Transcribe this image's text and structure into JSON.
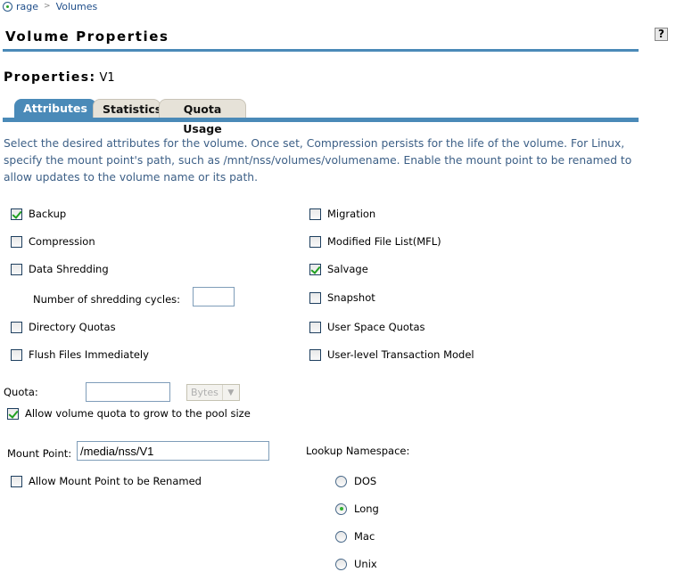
{
  "breadcrumb": {
    "items": [
      "rage",
      "Volumes"
    ],
    "separator": ">"
  },
  "header": {
    "title": "Volume Properties",
    "help_label": "?"
  },
  "properties": {
    "label": "Properties:",
    "value": "V1"
  },
  "tabs": [
    {
      "label": "Attributes",
      "active": true
    },
    {
      "label": "Statistics",
      "active": false
    },
    {
      "label": "Quota Usage",
      "active": false
    }
  ],
  "description": "Select the desired attributes for the volume. Once set, Compression persists for the life of the volume. For Linux, specify the mount point's path, such as /mnt/nss/volumes/volumename. Enable the mount point to be renamed to allow updates to the volume name or its path.",
  "attributes_left": [
    {
      "label": "Backup",
      "checked": true
    },
    {
      "label": "Compression",
      "checked": false
    },
    {
      "label": "Data Shredding",
      "checked": false
    },
    {
      "label": "Directory Quotas",
      "checked": false
    },
    {
      "label": "Flush Files Immediately",
      "checked": false
    }
  ],
  "shredding_cycles": {
    "label": "Number of shredding cycles:",
    "value": ""
  },
  "attributes_right": [
    {
      "label": "Migration",
      "checked": false
    },
    {
      "label": "Modified File List(MFL)",
      "checked": false
    },
    {
      "label": "Salvage",
      "checked": true
    },
    {
      "label": "Snapshot",
      "checked": false
    },
    {
      "label": "User Space Quotas",
      "checked": false
    },
    {
      "label": "User-level Transaction Model",
      "checked": false
    }
  ],
  "quota": {
    "label": "Quota:",
    "value": "",
    "unit": "Bytes",
    "grow_label": "Allow volume quota to grow to the pool size",
    "grow_checked": true
  },
  "mount_point": {
    "label": "Mount Point:",
    "value": "/media/nss/V1",
    "rename_label": "Allow Mount Point to be Renamed",
    "rename_checked": false
  },
  "namespace": {
    "label": "Lookup Namespace:",
    "options": [
      {
        "label": "DOS",
        "selected": false
      },
      {
        "label": "Long",
        "selected": true
      },
      {
        "label": "Mac",
        "selected": false
      },
      {
        "label": "Unix",
        "selected": false
      }
    ]
  }
}
